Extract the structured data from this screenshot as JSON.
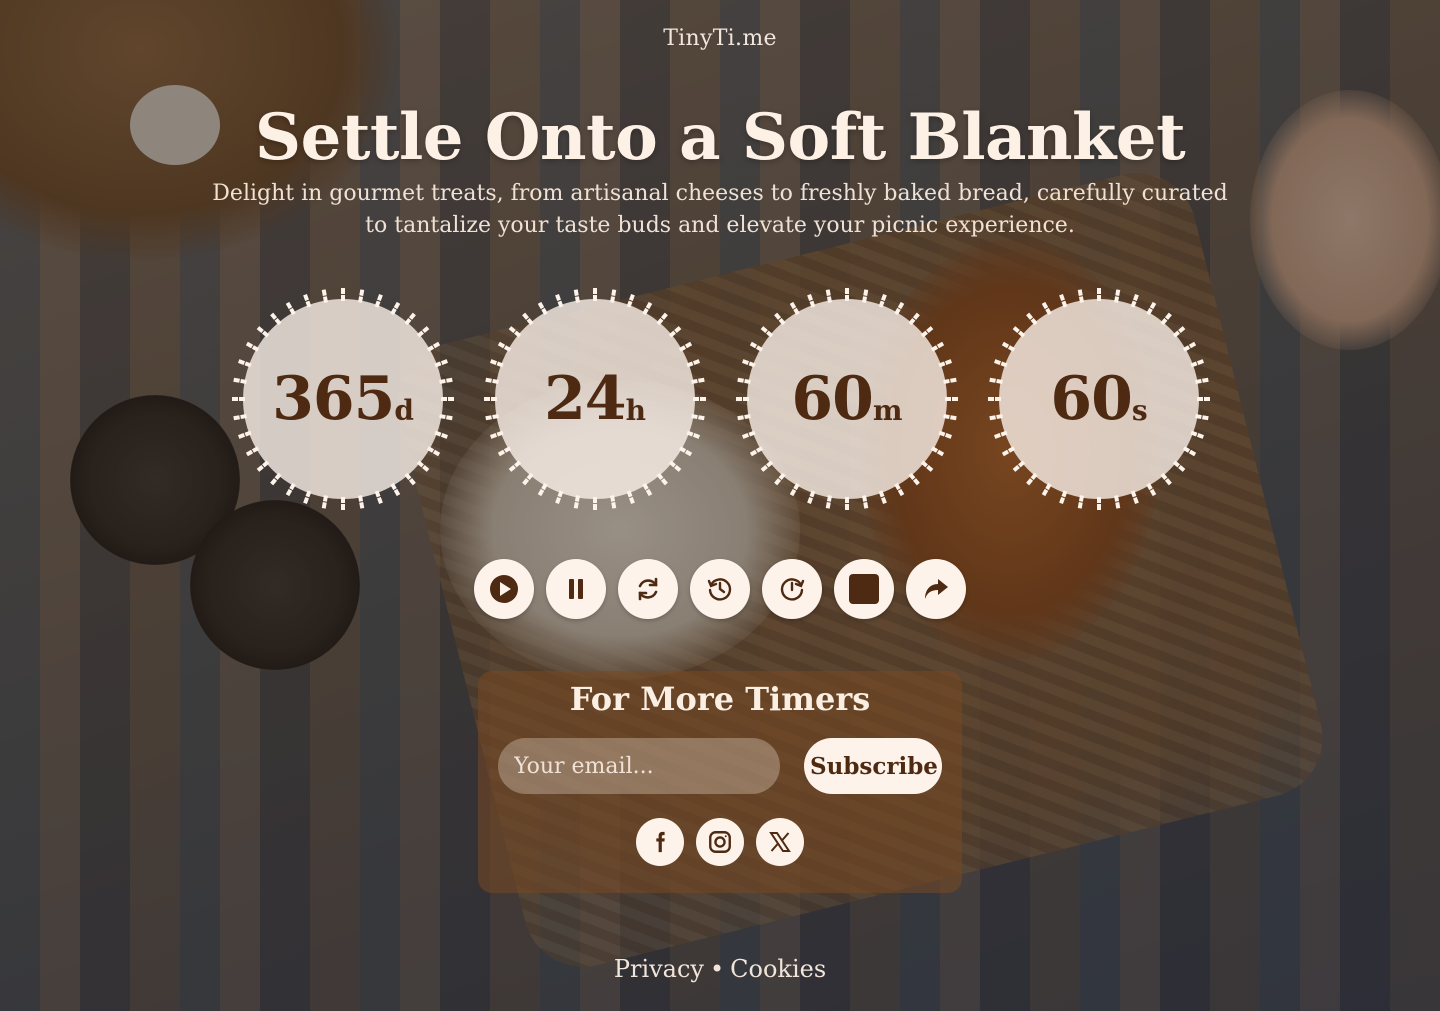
{
  "brand": "TinyTi.me",
  "headline": "Settle Onto a Soft Blanket",
  "subtitle": "Delight in gourmet treats, from artisanal cheeses to freshly baked bread, carefully curated to tantalize your taste buds and elevate your picnic experience.",
  "timers": [
    {
      "value": "365",
      "unit": "d"
    },
    {
      "value": "24",
      "unit": "h"
    },
    {
      "value": "60",
      "unit": "m"
    },
    {
      "value": "60",
      "unit": "s"
    }
  ],
  "controls": [
    {
      "name": "play-button",
      "icon": "play-icon"
    },
    {
      "name": "pause-button",
      "icon": "pause-icon"
    },
    {
      "name": "reset-button",
      "icon": "refresh-icon"
    },
    {
      "name": "history-button",
      "icon": "history-icon"
    },
    {
      "name": "timer-button",
      "icon": "clock-forward-icon"
    },
    {
      "name": "stop-button",
      "icon": "stop-icon"
    },
    {
      "name": "share-button",
      "icon": "share-icon"
    }
  ],
  "subscribe": {
    "title": "For More Timers",
    "email_placeholder": "Your email...",
    "button_label": "Subscribe"
  },
  "social": [
    {
      "name": "facebook-button",
      "icon": "facebook-icon"
    },
    {
      "name": "instagram-button",
      "icon": "instagram-icon"
    },
    {
      "name": "x-button",
      "icon": "x-icon"
    }
  ],
  "footer": {
    "privacy": "Privacy",
    "separator": "•",
    "cookies": "Cookies"
  },
  "colors": {
    "accent_dark": "#4e2a12",
    "button_bg": "#fdf3ea",
    "text_light": "#fdf1e6"
  }
}
